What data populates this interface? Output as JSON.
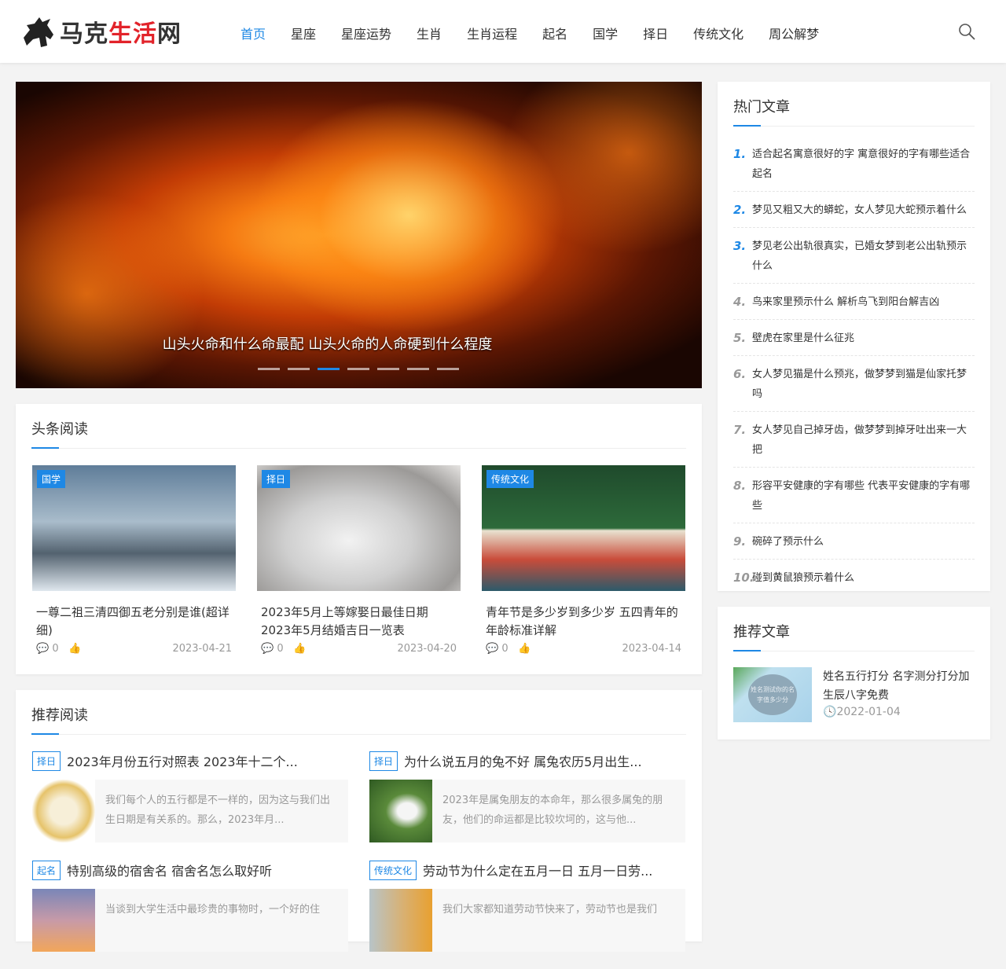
{
  "site": {
    "logo_black": "马克",
    "logo_red": "生活",
    "logo_black2": "网"
  },
  "nav": [
    "首页",
    "星座",
    "星座运势",
    "生肖",
    "生肖运程",
    "起名",
    "国学",
    "择日",
    "传统文化",
    "周公解梦"
  ],
  "slider": {
    "caption": "山头火命和什么命最配 山头火命的人命硬到什么程度",
    "slides": 7,
    "active": 3
  },
  "headlines": {
    "title": "头条阅读",
    "items": [
      {
        "tag": "国学",
        "title": "一尊二祖三清四御五老分别是谁(超详细)",
        "comments": "0",
        "date": "2023-04-21"
      },
      {
        "tag": "择日",
        "title": "2023年5月上等嫁娶日最佳日期 2023年5月结婚吉日一览表",
        "comments": "0",
        "date": "2023-04-20"
      },
      {
        "tag": "传统文化",
        "title": "青年节是多少岁到多少岁 五四青年的年龄标准详解",
        "comments": "0",
        "date": "2023-04-14"
      }
    ]
  },
  "recommend": {
    "title": "推荐阅读",
    "items": [
      {
        "tag": "择日",
        "title": "2023年月份五行对照表 2023年十二个...",
        "desc": "我们每个人的五行都是不一样的，因为这与我们出生日期是有关系的。那么，2023年月..."
      },
      {
        "tag": "择日",
        "title": "为什么说五月的兔不好 属兔农历5月出生...",
        "desc": "2023年是属兔朋友的本命年，那么很多属兔的朋友，他们的命运都是比较坎坷的，这与他..."
      },
      {
        "tag": "起名",
        "title": "特别高级的宿舍名 宿舍名怎么取好听",
        "desc": "当谈到大学生活中最珍贵的事物时，一个好的住"
      },
      {
        "tag": "传统文化",
        "title": "劳动节为什么定在五月一日 五月一日劳...",
        "desc": "我们大家都知道劳动节快来了，劳动节也是我们"
      }
    ]
  },
  "hot": {
    "title": "热门文章",
    "items": [
      "适合起名寓意很好的字 寓意很好的字有哪些适合起名",
      "梦见又粗又大的蟒蛇，女人梦见大蛇预示着什么",
      "梦见老公出轨很真实，已婚女梦到老公出轨预示什么",
      "鸟来家里预示什么 解析鸟飞到阳台解吉凶",
      "壁虎在家里是什么征兆",
      "女人梦见猫是什么预兆，做梦梦到猫是仙家托梦吗",
      "女人梦见自己掉牙齿，做梦梦到掉牙吐出来一大把",
      "形容平安健康的字有哪些 代表平安健康的字有哪些",
      "碗碎了预示什么",
      "碰到黄鼠狼预示着什么"
    ],
    "numbers": [
      "1.",
      "2.",
      "3.",
      "4.",
      "5.",
      "6.",
      "7.",
      "8.",
      "9.",
      "10."
    ]
  },
  "side_rec": {
    "title": "推荐文章",
    "item": {
      "title": "姓名五行打分 名字测分打分加生辰八字免费",
      "date": "2022-01-04",
      "thumb_text": "姓名测试你的名字值多少分"
    }
  },
  "colors": {
    "accent": "#1e88e5",
    "logo_red": "#e2232a"
  }
}
